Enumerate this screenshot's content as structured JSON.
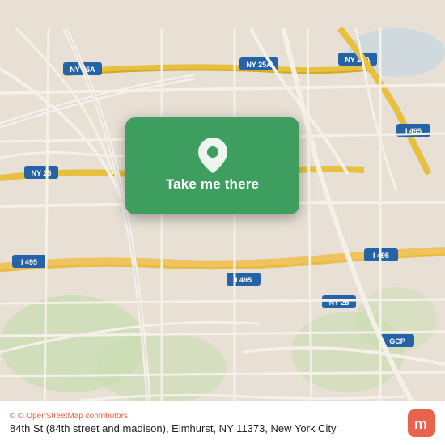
{
  "map": {
    "background_color": "#e8e0d5",
    "center_label": "Take me there",
    "pin_icon": "📍"
  },
  "bottom_bar": {
    "osm_credit": "© OpenStreetMap contributors",
    "address": "84th St (84th street and madison), Elmhurst, NY 11373, New York City",
    "logo_letter": "m"
  }
}
